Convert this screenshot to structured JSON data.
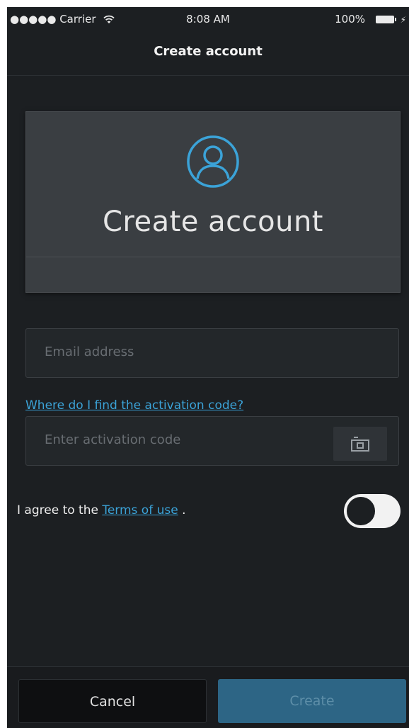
{
  "status_bar": {
    "carrier": "●●●●● Carrier",
    "time": "8:08 AM",
    "battery": "100%"
  },
  "nav": {
    "title": "Create account"
  },
  "hero": {
    "title": "Create account",
    "icon": "user-circle-icon"
  },
  "form": {
    "email_placeholder": "Email address",
    "activation_link": "Where do I find the activation code?",
    "activation_placeholder": "Enter activation code",
    "terms_prefix": "I agree to the",
    "terms_link": "Terms of use",
    "terms_suffix": " .",
    "toggle_on": false
  },
  "actions": {
    "cancel_label": "Cancel",
    "create_label": "Create"
  },
  "colors": {
    "accent": "#3ba3d8",
    "background": "#1c1f22",
    "create_button": "#2d6585"
  }
}
